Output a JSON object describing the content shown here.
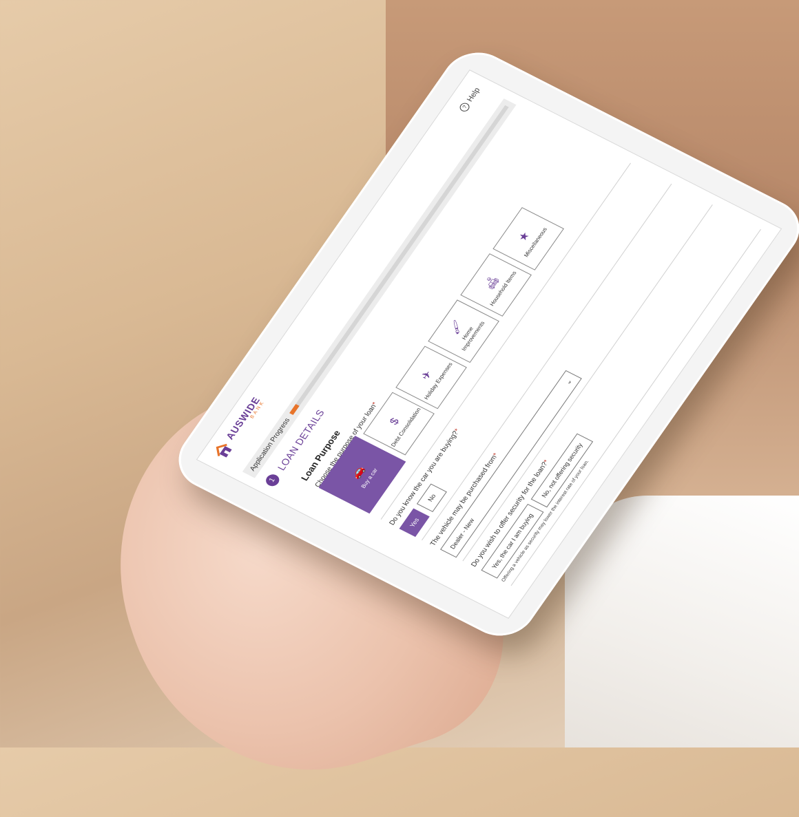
{
  "app": {
    "brand_word": "AUSWIDE",
    "brand_sub": "BANK",
    "help_label": "Help"
  },
  "progress": {
    "label": "Application Progress",
    "value": 0.03
  },
  "section": {
    "step": "1",
    "title": "LOAN DETAILS",
    "subtitle": "Loan Purpose"
  },
  "purpose": {
    "question": "Choose the purpose of your loan",
    "required_mark": "*",
    "options": [
      {
        "label": "Buy a car",
        "icon": "car-icon",
        "glyph": "🚗",
        "selected": true
      },
      {
        "label": "Debt Consolidation",
        "icon": "dollar-icon",
        "glyph": "$",
        "selected": false
      },
      {
        "label": "Holiday Expenses",
        "icon": "plane-icon",
        "glyph": "✈",
        "selected": false
      },
      {
        "label": "Home Improvements",
        "icon": "paint-roller-icon",
        "glyph": "🖌",
        "selected": false
      },
      {
        "label": "Household Items",
        "icon": "sofa-icon",
        "glyph": "🛋",
        "selected": false
      },
      {
        "label": "Miscellaneous",
        "icon": "star-icon",
        "glyph": "★",
        "selected": false
      }
    ]
  },
  "know_car": {
    "question": "Do you know the car you are buying?",
    "required_mark": "*",
    "yes": "Yes",
    "no": "No",
    "selected": "Yes"
  },
  "purchased_from": {
    "question": "The vehicle may be purchased from",
    "required_mark": "*",
    "value": "Dealer - New"
  },
  "security": {
    "question": "Do you wish to offer security for the loan?",
    "required_mark": "*",
    "option_yes": "Yes, the car I am buying",
    "option_no": "No, not offering security",
    "note": "Offering a vehicle as security may lower the interest rate of your loan."
  },
  "colors": {
    "brand_purple": "#6a3f97",
    "accent_orange": "#e8742a"
  }
}
